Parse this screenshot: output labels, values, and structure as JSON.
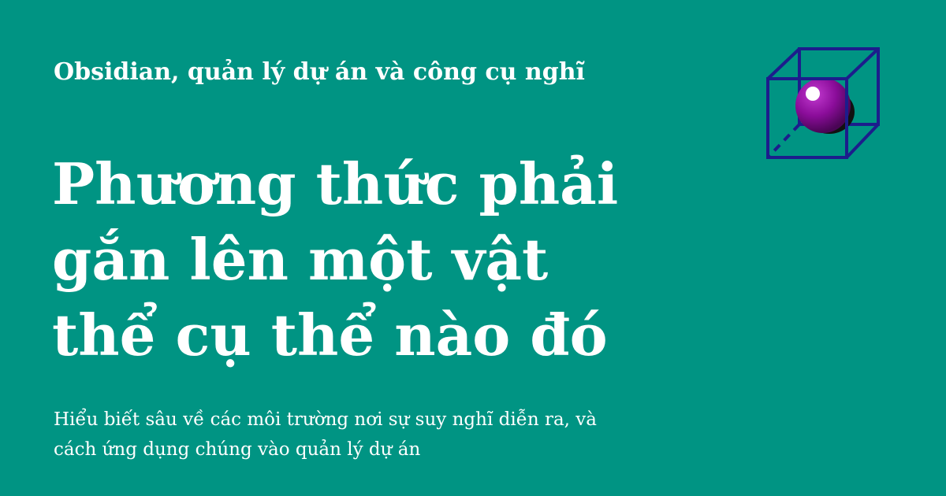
{
  "series_label": "Obsidian, quản lý dự án và công cụ nghĩ",
  "headline": {
    "lines": [
      "Phương thức phải",
      "gắn lên một vật",
      "thể cụ thể nào đó"
    ]
  },
  "description": {
    "lines": [
      "Hiểu biết sâu về các môi trường nơi sự suy nghĩ diễn ra, và",
      "cách ứng dụng chúng vào quản lý dự án"
    ]
  },
  "colors": {
    "background": "#009483",
    "text": "#ffffff",
    "cube_stroke": "#1c1d8c",
    "sphere": "#8b0d9a"
  },
  "icons": {
    "logo": "cube-with-sphere-icon"
  }
}
